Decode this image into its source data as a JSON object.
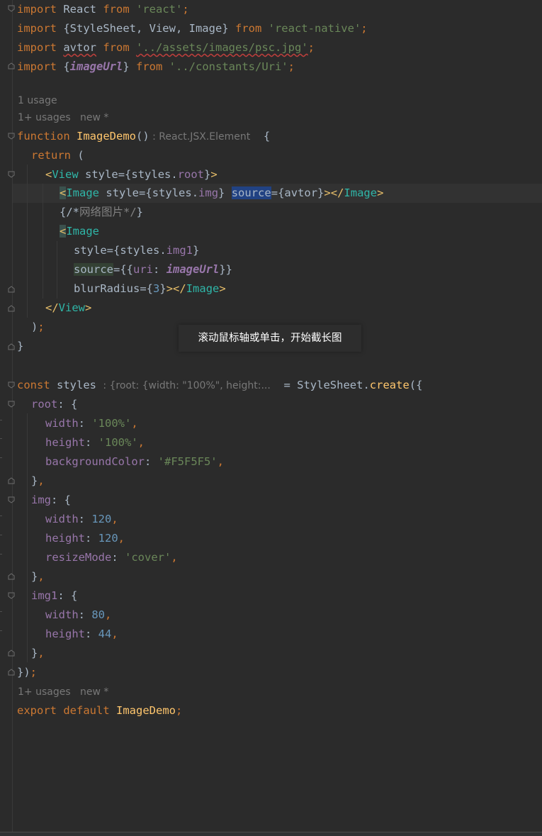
{
  "code": {
    "l1": {
      "kw1": "import",
      "t1": " React ",
      "kw2": "from",
      "t2": " ",
      "s1": "'react'",
      "t3": ";"
    },
    "l2": {
      "kw1": "import",
      "t1": " {StyleSheet, View, Image} ",
      "kw2": "from",
      "t2": " ",
      "s1": "'react-native'",
      "t3": ";"
    },
    "l3": {
      "kw1": "import",
      "t1": " ",
      "v": "avtor",
      "t2": " ",
      "kw2": "from",
      "t3": " ",
      "s1": "'../assets/images/psc.jpg'",
      "t4": ";"
    },
    "l4": {
      "kw1": "import",
      "t1": " {",
      "v": "imageUrl",
      "t2": "} ",
      "kw2": "from",
      "t3": " ",
      "s1": "'../constants/Uri'",
      "t4": ";"
    },
    "hint1": "1 usage",
    "hint2": "1+ usages   new *",
    "l5": {
      "kw": "function",
      "sp": " ",
      "fn": "ImageDemo",
      "p": "()",
      "hint": " : React.JSX.Element",
      "brace": "  {"
    },
    "l6": {
      "kw": "return",
      "t": " ("
    },
    "l7": {
      "lt": "<",
      "tag": "View",
      "sp": " ",
      "attr": "style",
      "eq": "=",
      "ob": "{styles.",
      "prop": "root",
      "cb": "}",
      "gt": ">"
    },
    "l8": {
      "lt": "<",
      "tag": "Image",
      "sp": " ",
      "attr": "style",
      "eq": "=",
      "ob": "{styles.",
      "prop": "img",
      "cb": "}",
      "sp2": " ",
      "attr2": "source",
      "eq2": "=",
      "v": "{avtor}",
      "close1": ">",
      "close2": "</",
      "tag2": "Image",
      "close3": ">"
    },
    "l9": {
      "t": "{/*",
      "comment": "网络图片*/",
      "t2": "}"
    },
    "l10": {
      "lt": "<",
      "tag": "Image"
    },
    "l11": {
      "attr": "style",
      "eq": "=",
      "ob": "{styles.",
      "prop": "img1",
      "cb": "}"
    },
    "l12": {
      "attr": "source",
      "eq": "=",
      "ob": "{{",
      "k": "uri",
      "c": ": ",
      "v": "imageUrl",
      "cb": "}}"
    },
    "l13": {
      "attr": "blurRadius",
      "eq": "=",
      "ob": "{",
      "n": "3",
      "cb": "}",
      "close1": "></",
      "tag": "Image",
      "close2": ">"
    },
    "l14": {
      "lt": "</",
      "tag": "View",
      "gt": ">"
    },
    "l15": {
      "p": ")",
      "semi": ";"
    },
    "l16": {
      "t": "}"
    },
    "l17": {
      "kw": "const",
      "t": " styles ",
      "hint": ": {root: {width: \"100%\", height:...",
      "eq": "  = StyleSheet.",
      "fn": "create",
      "t2": "({"
    },
    "l18": {
      "k": "root",
      "t": ": {"
    },
    "l19": {
      "k": "width",
      "t": ": ",
      "s": "'100%'",
      "c": ","
    },
    "l20": {
      "k": "height",
      "t": ": ",
      "s": "'100%'",
      "c": ","
    },
    "l21": {
      "k": "backgroundColor",
      "t": ": ",
      "s": "'#F5F5F5'",
      "c": ","
    },
    "l22": {
      "t": "}",
      "c": ","
    },
    "l23": {
      "k": "img",
      "t": ": {"
    },
    "l24": {
      "k": "width",
      "t": ": ",
      "n": "120",
      "c": ","
    },
    "l25": {
      "k": "height",
      "t": ": ",
      "n": "120",
      "c": ","
    },
    "l26": {
      "k": "resizeMode",
      "t": ": ",
      "s": "'cover'",
      "c": ","
    },
    "l27": {
      "t": "}",
      "c": ","
    },
    "l28": {
      "k": "img1",
      "t": ": {"
    },
    "l29": {
      "k": "width",
      "t": ": ",
      "n": "80",
      "c": ","
    },
    "l30": {
      "k": "height",
      "t": ": ",
      "n": "44",
      "c": ","
    },
    "l31": {
      "t": "}",
      "c": ","
    },
    "l32": {
      "t": "})",
      "c": ";"
    },
    "hint3": "1+ usages   new *",
    "l33": {
      "kw1": "export",
      "sp": " ",
      "kw2": "default",
      "sp2": " ",
      "fn": "ImageDemo",
      "c": ";"
    }
  },
  "tooltip": {
    "text": "滚动鼠标轴或单击，开始截长图"
  },
  "colors": {
    "background": "#2b2b2b",
    "keyword": "#cc7832",
    "string": "#6a8759",
    "function": "#ffc66d",
    "jsx_tag": "#e8bf6a",
    "property": "#9876aa",
    "number": "#6897bb",
    "selection": "#214283"
  }
}
